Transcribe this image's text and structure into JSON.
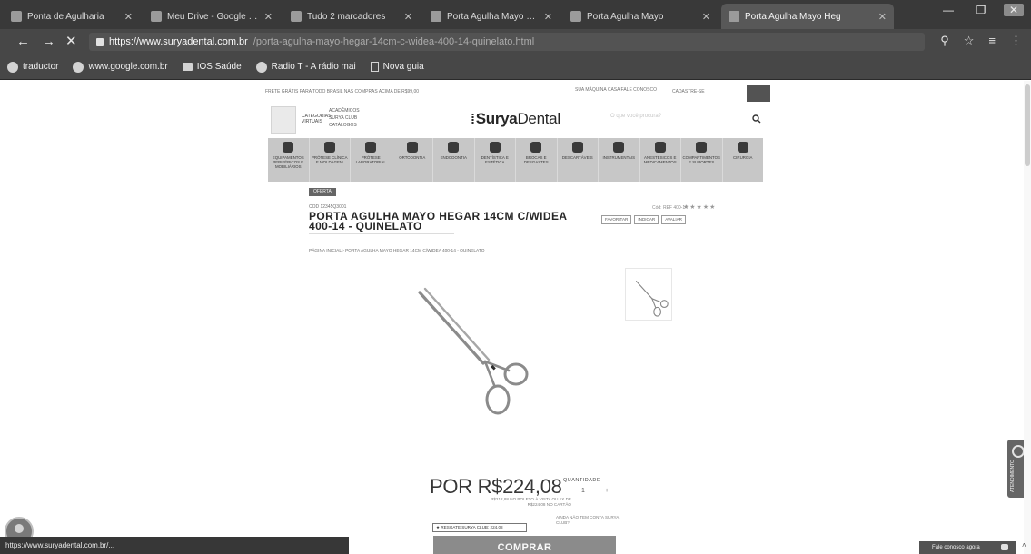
{
  "browser": {
    "tabs": [
      {
        "label": "Ponta de Agulharia"
      },
      {
        "label": "Meu Drive - Google Dri"
      },
      {
        "label": "Tudo 2 marcadores"
      },
      {
        "label": "Porta Agulha Mayo Heg"
      },
      {
        "label": "Porta Agulha Mayo"
      },
      {
        "label": "Porta Agulha Mayo Heg",
        "active": true
      }
    ],
    "url_host": "https://www.suryadental.com.br",
    "url_path": "/porta-agulha-mayo-hegar-14cm-c-widea-400-14-quinelato.html",
    "bookmarks": [
      {
        "label": "traductor",
        "icon": "google-icon"
      },
      {
        "label": "www.google.com.br",
        "icon": "google-icon"
      },
      {
        "label": "IOS Saúde",
        "icon": "folder-icon"
      },
      {
        "label": "Radio T - A rádio mai",
        "icon": "radio-icon"
      },
      {
        "label": "Nova guia",
        "icon": "page-icon"
      }
    ]
  },
  "store": {
    "free_shipping": "FRETE GRÁTIS PARA TODO BRASIL NAS COMPRAS ACIMA DE R$99,00",
    "help": "SUA MÁQUINA CASA FALE CONOSCO",
    "account": "CADASTRE-SE",
    "categories_label": "CATEGORIAS VIRTUAIS",
    "sub_links": [
      "ACADÊMICOS",
      "SURYA CLUB",
      "CATÁLOGOS"
    ],
    "logo_bold": "Surya",
    "logo_light": "Dental",
    "search_placeholder": "O que você procura?",
    "nav_categories": [
      "EQUIPAMENTOS PERIFÉRICOS E MOBILIÁRIOS",
      "PRÓTESE CLÍNICA E MOLDAGEM",
      "PRÓTESE LABORATORIAL",
      "ORTODONTIA",
      "ENDODONTIA",
      "DENTÍSTICA E ESTÉTICA",
      "BROCAS E DESGASTES",
      "DESCARTÁVEIS",
      "INSTRUMENTAIS",
      "ANESTÉSICOS E MEDICAMENTOS",
      "COMPARTIMENTOS E SUPORTES",
      "CIRURGIA"
    ]
  },
  "product": {
    "badge": "OFERTA",
    "brand": "COD 12345Q3001",
    "title": "PORTA AGULHA MAYO HEGAR 14CM C/WIDEA 400-14 - QUINELATO",
    "ref": "Cód: REF 400-14",
    "stars": "★★★★★",
    "actions": [
      "FAVORITAR",
      "INDICAR",
      "AVALIAR"
    ],
    "breadcrumb": "PÁGINA INICIAL  ›  PORTA AGULHA MAYO HEGAR 14CM C/WIDEA 400-14 - QUINELATO",
    "price": "POR R$224,08",
    "price_sub": "R$212,88 NO BOLETO À VISTA OU 1X DE R$224,08 NO CARTÃO",
    "qty_label": "QUANTIDADE",
    "qty_minus": "−",
    "qty_value": "1",
    "qty_plus": "+",
    "surya_club": "★ RESGATE SURYA CLUB: 224,08",
    "club_note": "AINDA NÃO TEM CONTA SURYA CLUB?",
    "buy": "COMPRAR"
  },
  "overlays": {
    "status_url": "https://www.suryadental.com.br/...",
    "side_widget": "ATENDIMENTO",
    "chat_button": "Fale conosco agora",
    "corner_caret": "˄"
  }
}
